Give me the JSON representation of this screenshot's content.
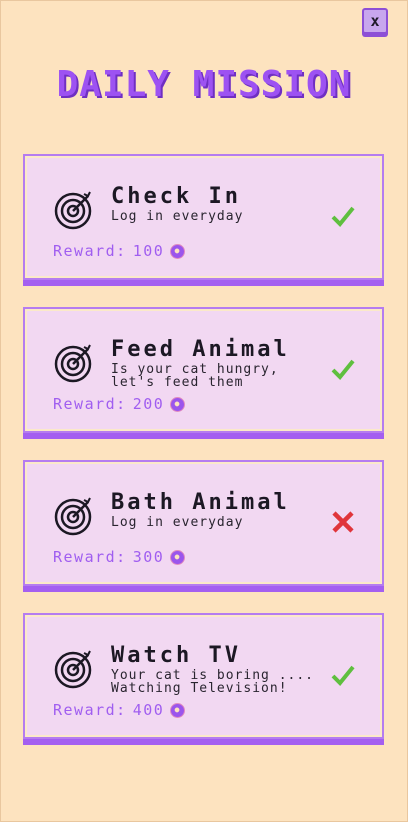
{
  "header": {
    "title": "DAILY MISSION",
    "close_label": "x"
  },
  "reward_prefix": "Reward:",
  "colors": {
    "background": "#fde3bf",
    "accent": "#9d52f2",
    "card_bg": "#f2d8f2",
    "complete": "#5fbf3f",
    "incomplete": "#e0353b"
  },
  "missions": [
    {
      "title": "Check In",
      "desc_line1": "Log in everyday",
      "desc_line2": "",
      "reward": "100",
      "status": "complete",
      "status_icon": "check-icon",
      "icon": "target-icon"
    },
    {
      "title": "Feed Animal",
      "desc_line1": "Is your cat hungry,",
      "desc_line2": "let's feed them",
      "reward": "200",
      "status": "complete",
      "status_icon": "check-icon",
      "icon": "target-icon"
    },
    {
      "title": "Bath Animal",
      "desc_line1": "Log in everyday",
      "desc_line2": "",
      "reward": "300",
      "status": "incomplete",
      "status_icon": "cross-icon",
      "icon": "target-icon"
    },
    {
      "title": "Watch TV",
      "desc_line1": "Your cat is boring ....",
      "desc_line2": "Watching Television!",
      "reward": "400",
      "status": "complete",
      "status_icon": "check-icon",
      "icon": "target-icon"
    }
  ]
}
